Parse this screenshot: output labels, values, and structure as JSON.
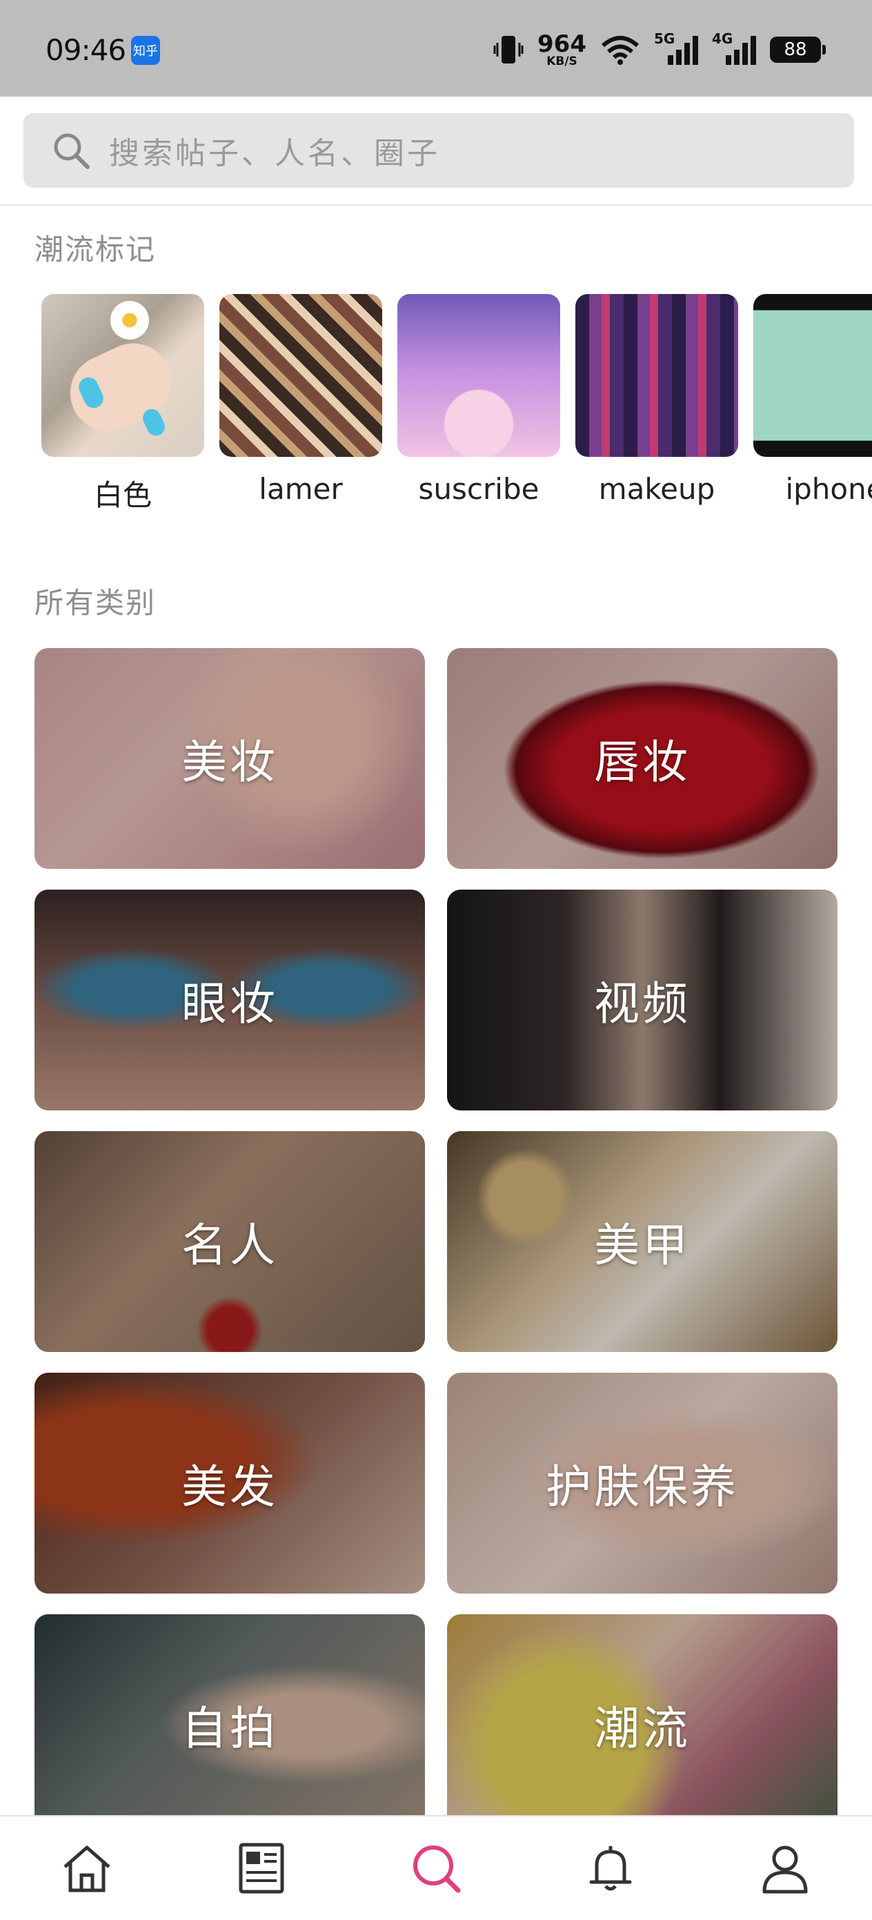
{
  "status_bar": {
    "time": "09:46",
    "app_badge": "知乎",
    "speed_value": "964",
    "speed_unit": "KB/S",
    "net_5g": "5G",
    "net_4g": "4G",
    "battery": "88"
  },
  "search": {
    "placeholder": "搜索帖子、人名、圈子"
  },
  "trending": {
    "title": "潮流标记",
    "tags": [
      {
        "label": "白色"
      },
      {
        "label": "lamer"
      },
      {
        "label": "suscribe"
      },
      {
        "label": "makeup"
      },
      {
        "label": "iphone"
      }
    ]
  },
  "categories": {
    "title": "所有类别",
    "items": [
      {
        "label": "美妆"
      },
      {
        "label": "唇妆"
      },
      {
        "label": "眼妆"
      },
      {
        "label": "视频"
      },
      {
        "label": "名人"
      },
      {
        "label": "美甲"
      },
      {
        "label": "美发"
      },
      {
        "label": "护肤保养"
      },
      {
        "label": "自拍"
      },
      {
        "label": "潮流"
      }
    ]
  },
  "bottom_nav": {
    "items": [
      "home-icon",
      "feed-icon",
      "search-icon",
      "bell-icon",
      "profile-icon"
    ],
    "active_color": "#e0407a"
  }
}
